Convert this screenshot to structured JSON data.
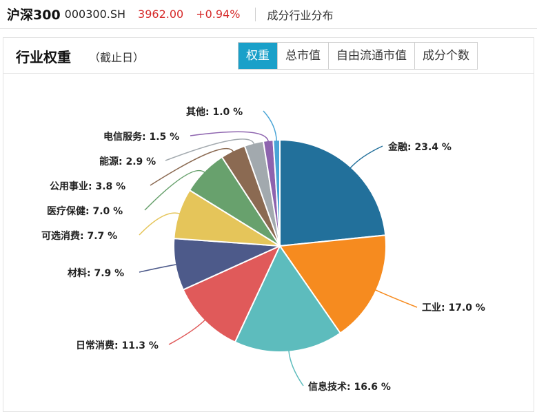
{
  "header": {
    "name": "沪深300",
    "code": "000300.SH",
    "price": "3962.00",
    "change": "+0.94%",
    "section": "成分行业分布"
  },
  "panel": {
    "title": "行业权重",
    "subtitle": "（截止日）",
    "tabs": [
      {
        "label": "权重",
        "active": true
      },
      {
        "label": "总市值",
        "active": false
      },
      {
        "label": "自由流通市值",
        "active": false
      },
      {
        "label": "成分个数",
        "active": false
      }
    ]
  },
  "chart_data": {
    "type": "pie",
    "unit": "%",
    "slices": [
      {
        "label": "金融",
        "value": 23.4,
        "color": "#22709b"
      },
      {
        "label": "工业",
        "value": 17.0,
        "color": "#f68b1f"
      },
      {
        "label": "信息技术",
        "value": 16.6,
        "color": "#5dbcbd"
      },
      {
        "label": "日常消费",
        "value": 11.3,
        "color": "#e05a5a"
      },
      {
        "label": "材料",
        "value": 7.9,
        "color": "#4d5a8a"
      },
      {
        "label": "可选消费",
        "value": 7.7,
        "color": "#e5c55a"
      },
      {
        "label": "医疗保健",
        "value": 7.0,
        "color": "#68a16d"
      },
      {
        "label": "公用事业",
        "value": 3.8,
        "color": "#8b6a52"
      },
      {
        "label": "能源",
        "value": 2.9,
        "color": "#a2a9ae"
      },
      {
        "label": "电信服务",
        "value": 1.5,
        "color": "#8d63ae"
      },
      {
        "label": "其他",
        "value": 1.0,
        "color": "#48a4d6"
      }
    ]
  }
}
